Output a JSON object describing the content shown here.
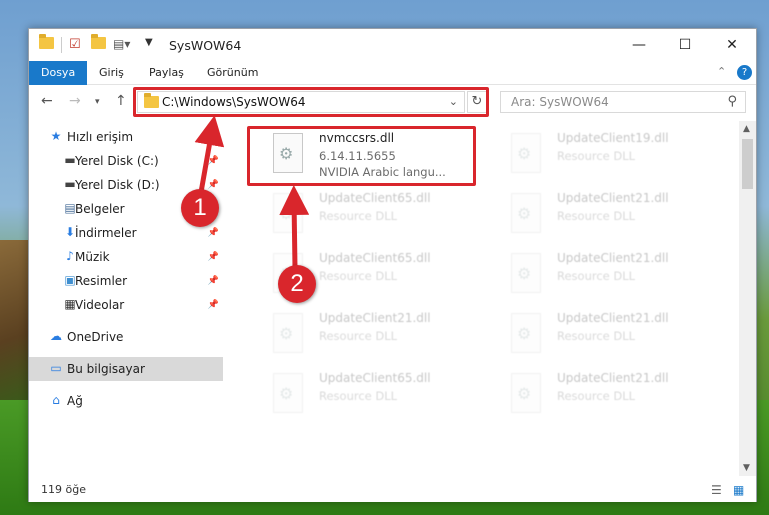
{
  "window": {
    "title": "SysWOW64",
    "minimize": "—",
    "maximize": "☐",
    "close": "✕"
  },
  "ribbon": {
    "tabs": [
      "Dosya",
      "Giriş",
      "Paylaş",
      "Görünüm"
    ],
    "collapse": "⌃",
    "help": "?"
  },
  "address": {
    "path": "C:\\Windows\\SysWOW64",
    "search_placeholder": "Ara: SysWOW64"
  },
  "nav": {
    "items": [
      {
        "label": "Hızlı erişim",
        "icon": "star-icon",
        "glyph": "★",
        "color": "#2a7de1"
      },
      {
        "label": "Yerel Disk (C:)",
        "icon": "drive-icon",
        "glyph": "▬",
        "color": "#444444"
      },
      {
        "label": "Yerel Disk (D:)",
        "icon": "drive-icon",
        "glyph": "▬",
        "color": "#444444"
      },
      {
        "label": "Belgeler",
        "icon": "documents-icon",
        "glyph": "▤",
        "color": "#4a6f9a"
      },
      {
        "label": "İndirmeler",
        "icon": "download-icon",
        "glyph": "⬇",
        "color": "#2a7de1"
      },
      {
        "label": "Müzik",
        "icon": "music-icon",
        "glyph": "♪",
        "color": "#2a7de1"
      },
      {
        "label": "Resimler",
        "icon": "pictures-icon",
        "glyph": "▣",
        "color": "#3f8fd0"
      },
      {
        "label": "Videolar",
        "icon": "videos-icon",
        "glyph": "▦",
        "color": "#333333"
      },
      {
        "label": "OneDrive",
        "icon": "cloud-icon",
        "glyph": "☁",
        "color": "#2a7de1"
      },
      {
        "label": "Bu bilgisayar",
        "icon": "computer-icon",
        "glyph": "▭",
        "color": "#2a7de1"
      },
      {
        "label": "Ağ",
        "icon": "network-icon",
        "glyph": "⌂",
        "color": "#2a7de1"
      }
    ]
  },
  "files": {
    "selected": {
      "name": "nvmccsrs.dll",
      "version": "6.14.11.5655",
      "description": "NVIDIA Arabic langu..."
    },
    "ghosts": [
      {
        "name": "UpdateClient19.dll",
        "desc": "Resource DLL"
      },
      {
        "name": "UpdateClient65.dll",
        "desc": "Resource DLL"
      },
      {
        "name": "UpdateClient21.dll",
        "desc": "Resource DLL"
      },
      {
        "name": "UpdateClient65.dll",
        "desc": "Resource DLL"
      },
      {
        "name": "UpdateClient21.dll",
        "desc": "Resource DLL"
      },
      {
        "name": "UpdateClient21.dll",
        "desc": "Resource DLL"
      },
      {
        "name": "UpdateClient21.dll",
        "desc": "Resource DLL"
      },
      {
        "name": "UpdateClient65.dll",
        "desc": "Resource DLL"
      },
      {
        "name": "UpdateClient21.dll",
        "desc": "Resource DLL"
      }
    ]
  },
  "status": {
    "count": "119 öğe"
  },
  "markers": [
    "1",
    "2"
  ],
  "colors": {
    "accent": "#1979ca",
    "highlight": "#d9262c"
  }
}
